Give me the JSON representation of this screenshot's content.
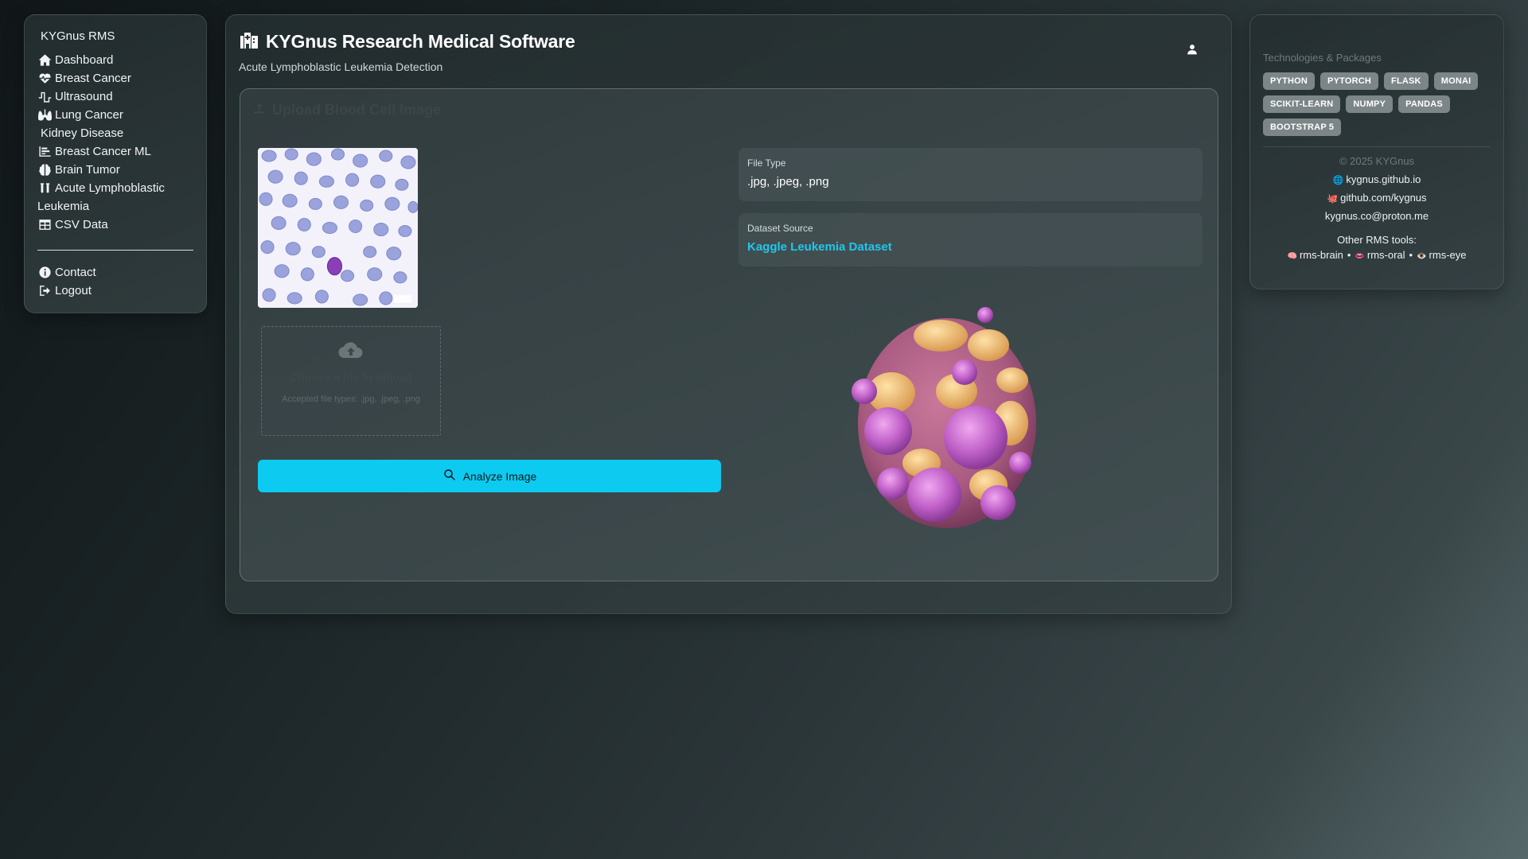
{
  "sidebar": {
    "brand": "KYGnus RMS",
    "items": [
      {
        "label": "Dashboard",
        "icon": "home-icon"
      },
      {
        "label": "Breast Cancer",
        "icon": "heart-pulse-icon"
      },
      {
        "label": "Ultrasound",
        "icon": "wave-square-icon"
      },
      {
        "label": "Lung Cancer",
        "icon": "lungs-icon"
      },
      {
        "label": "Kidney Disease",
        "icon": ""
      },
      {
        "label": "Breast Cancer ML",
        "icon": "chart-bar-icon"
      },
      {
        "label": "Brain Tumor",
        "icon": "brain-icon"
      },
      {
        "label": "Acute Lymphoblastic",
        "label2": "Leukemia",
        "icon": "vials-icon"
      },
      {
        "label": "CSV Data",
        "icon": "table-icon"
      }
    ],
    "bottom": [
      {
        "label": "Contact",
        "icon": "info-circle-icon"
      },
      {
        "label": "Logout",
        "icon": "sign-out-icon"
      }
    ]
  },
  "header": {
    "title": "KYGnus Research Medical Software",
    "subtitle": "Acute Lymphoblastic Leukemia Detection",
    "icon": "hospital-icon"
  },
  "upload": {
    "card_title": "Upload Blood Cell Image",
    "dropzone_title": "Choose a file to upload",
    "dropzone_hint": "Accepted file types: .jpg, .jpeg, .png",
    "analyze_label": "Analyze Image"
  },
  "info": {
    "file_type_label": "File Type",
    "file_type_value": ".jpg, .jpeg, .png",
    "dataset_label": "Dataset Source",
    "dataset_link": "Kaggle Leukemia Dataset"
  },
  "right": {
    "tech_title": "Technologies & Packages",
    "tags": [
      "PYTHON",
      "PYTORCH",
      "FLASK",
      "MONAI",
      "SCIKIT-LEARN",
      "NUMPY",
      "PANDAS",
      "BOOTSTRAP 5"
    ],
    "copyright": "© 2025 KYGnus",
    "links": [
      {
        "emoji": "🌐",
        "text": "kygnus.github.io"
      },
      {
        "emoji": "🐙",
        "text": "github.com/kygnus"
      },
      {
        "emoji": "",
        "text": "kygnus.co@proton.me"
      }
    ],
    "other_title": "Other RMS tools:",
    "tools": [
      {
        "emoji": "🧠",
        "text": "rms-brain"
      },
      {
        "emoji": "👄",
        "text": "rms-oral"
      },
      {
        "emoji": "👁️",
        "text": "rms-eye"
      }
    ]
  },
  "colors": {
    "accent": "#0dcaf0",
    "link": "#1fc7ee",
    "tag_bg": "#7c8587"
  }
}
